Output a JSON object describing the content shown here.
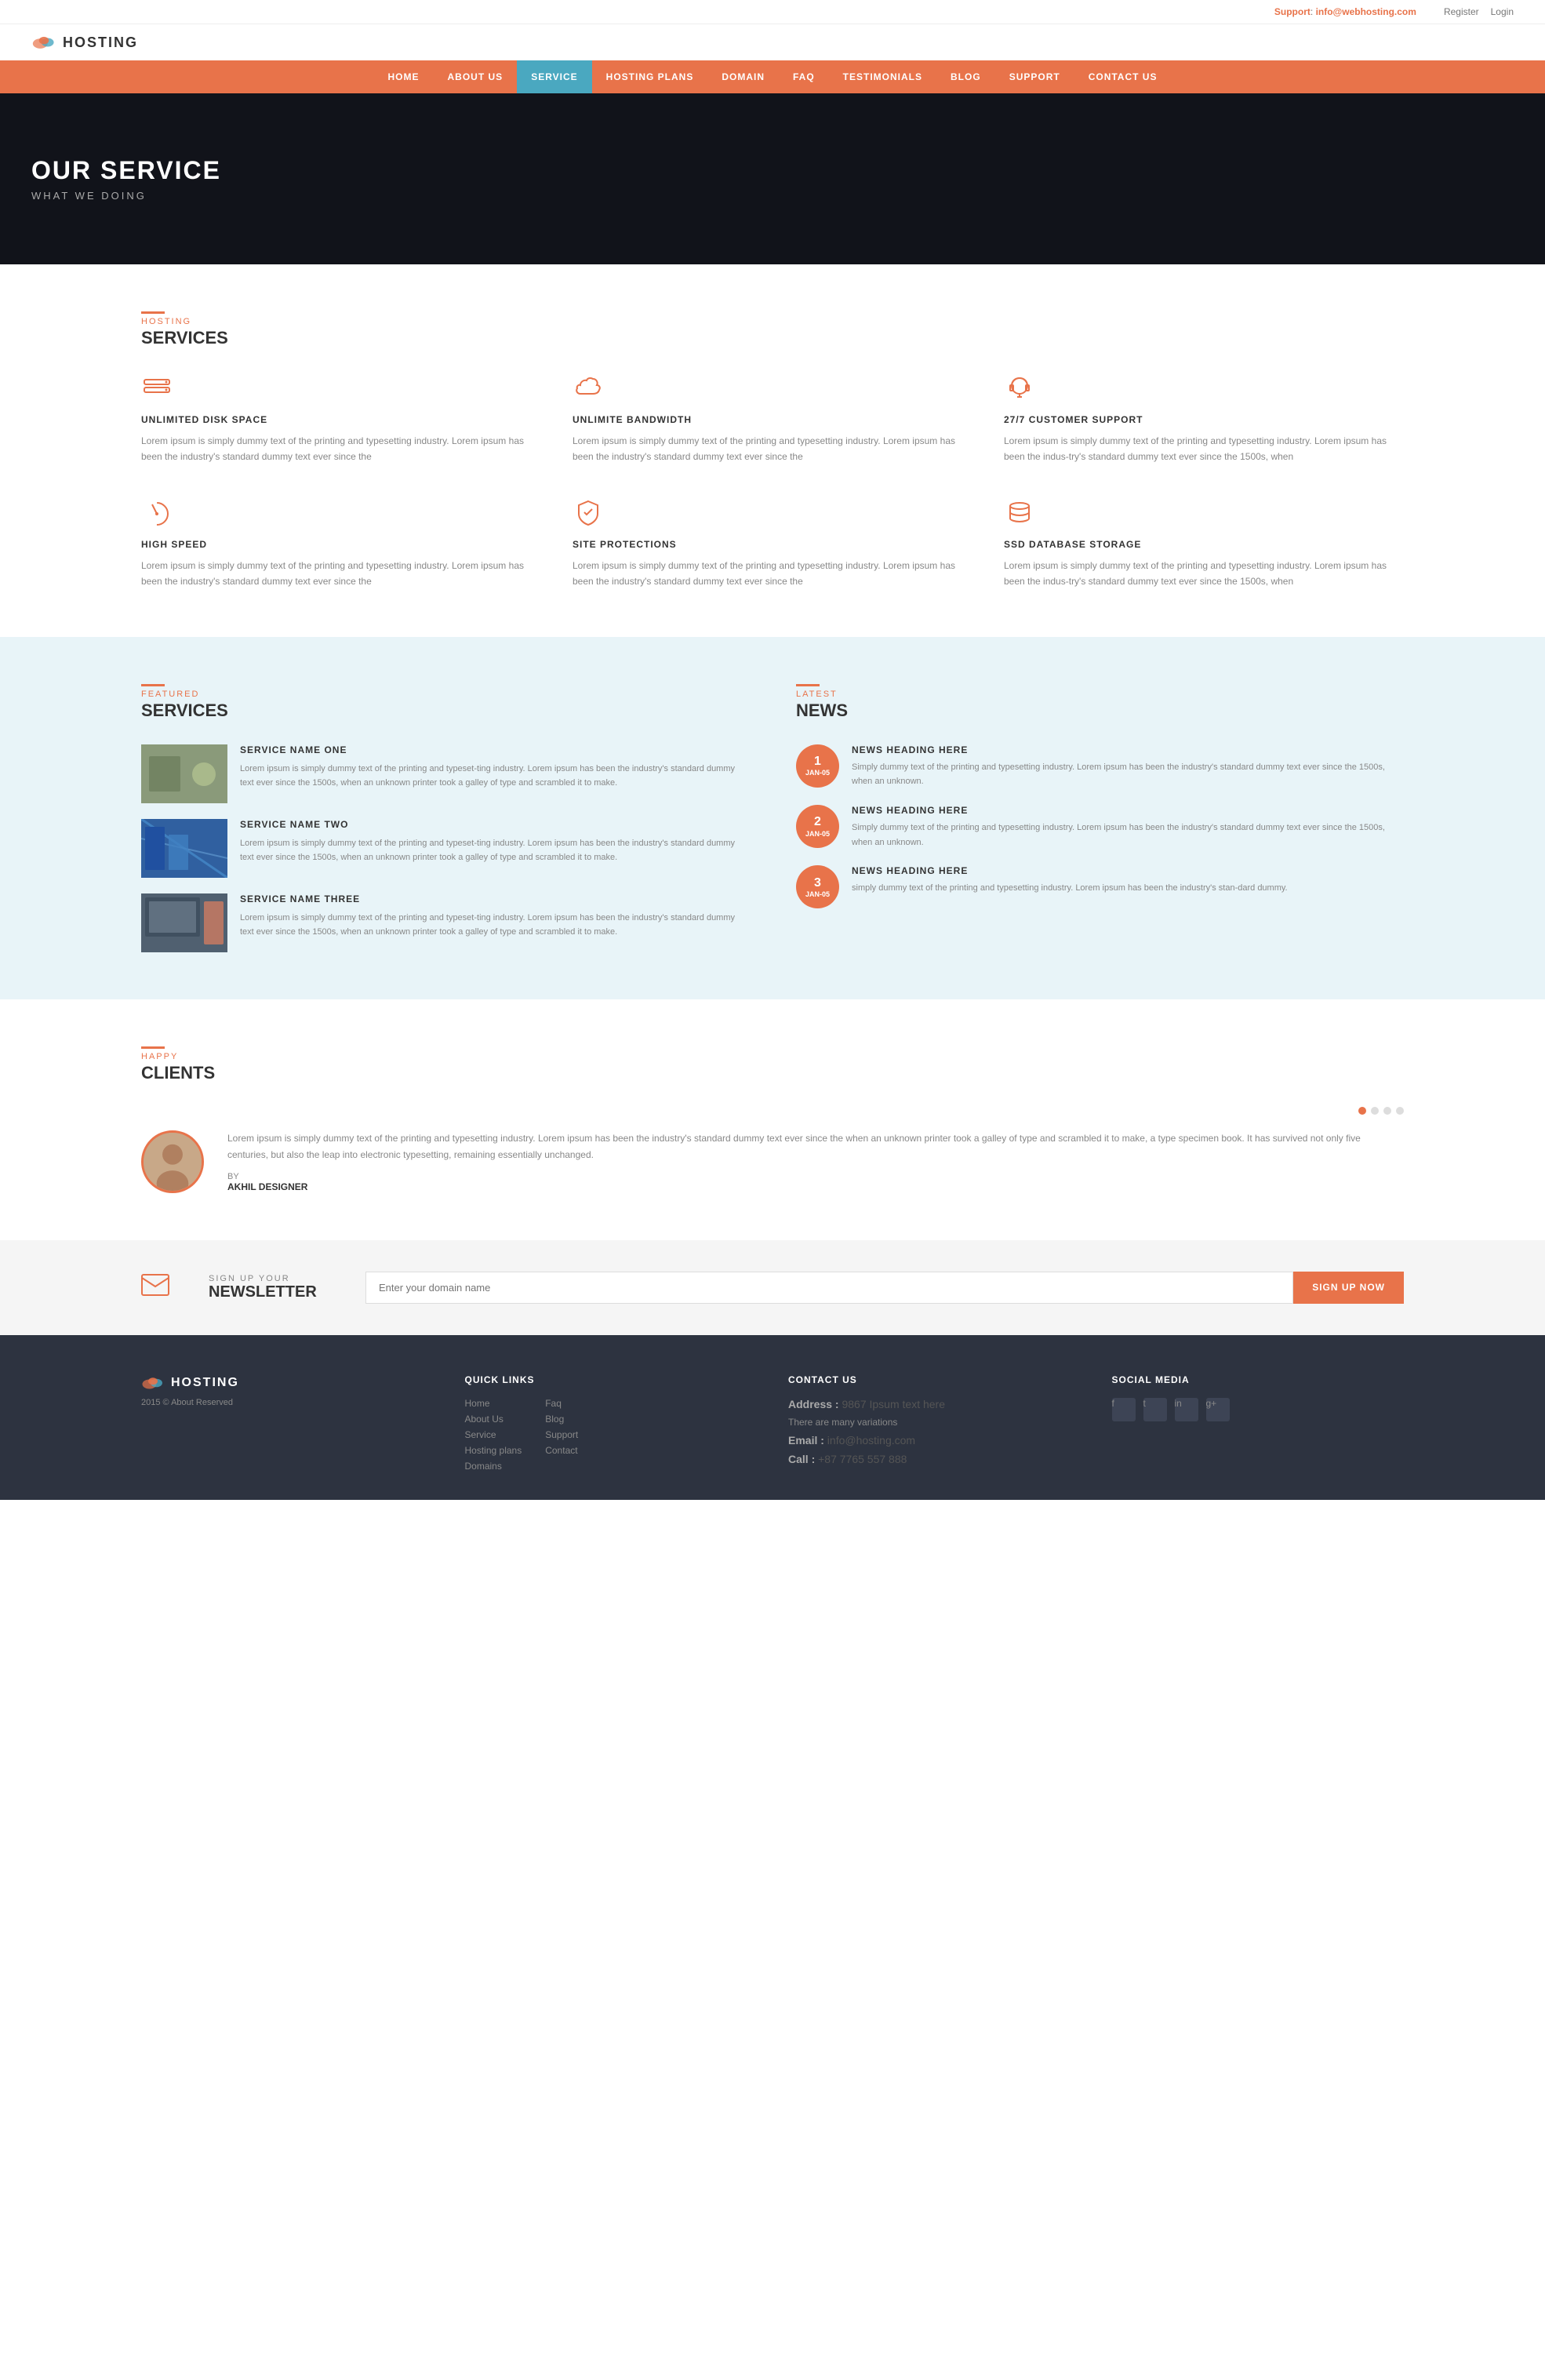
{
  "header": {
    "logo_text": "HOSTING",
    "support_label": "Support",
    "support_email": "info@webhosting.com",
    "register": "Register",
    "login": "Login"
  },
  "nav": {
    "items": [
      {
        "label": "HOME",
        "active": false
      },
      {
        "label": "ABOUT US",
        "active": false
      },
      {
        "label": "SERVICE",
        "active": true
      },
      {
        "label": "HOSTING PLANS",
        "active": false
      },
      {
        "label": "DOMAIN",
        "active": false
      },
      {
        "label": "FAQ",
        "active": false
      },
      {
        "label": "TESTIMONIALS",
        "active": false
      },
      {
        "label": "BLOG",
        "active": false
      },
      {
        "label": "SUPPORT",
        "active": false
      },
      {
        "label": "CONTACT US",
        "active": false
      }
    ]
  },
  "hero": {
    "title": "OUR SERVICE",
    "subtitle": "WHAT WE DOING"
  },
  "hosting_services": {
    "label": "HOSTING",
    "title": "SERVICES",
    "items": [
      {
        "icon": "disk",
        "title": "UNLIMITED DISK SPACE",
        "text": "Lorem ipsum is simply dummy text of the printing and typesetting industry. Lorem ipsum has been the industry's standard dummy text ever since the"
      },
      {
        "icon": "cloud",
        "title": "UNLIMITE BANDWIDTH",
        "text": "Lorem ipsum is simply dummy text of the printing and typesetting industry. Lorem ipsum has been the industry's standard dummy text ever since the"
      },
      {
        "icon": "headset",
        "title": "27/7 CUSTOMER SUPPORT",
        "text": "Lorem ipsum is simply dummy text of the printing and typesetting industry. Lorem ipsum has been the indus-try's standard dummy text ever since the 1500s, when"
      },
      {
        "icon": "speed",
        "title": "HIGH SPEED",
        "text": "Lorem ipsum is simply dummy text of the printing and typesetting industry. Lorem ipsum has been the industry's standard dummy text ever since the"
      },
      {
        "icon": "shield",
        "title": "SITE PROTECTIONS",
        "text": "Lorem ipsum is simply dummy text of the printing and typesetting industry. Lorem ipsum has been the industry's standard dummy text ever since the"
      },
      {
        "icon": "database",
        "title": "SSD DATABASE STORAGE",
        "text": "Lorem ipsum is simply dummy text of the printing and typesetting industry. Lorem ipsum has been the indus-try's standard dummy text ever since the 1500s, when"
      }
    ]
  },
  "featured": {
    "label": "FEATURED",
    "title": "SERVICES",
    "items": [
      {
        "title": "SERVICE NAME ONE",
        "text": "Lorem ipsum is simply dummy text of the printing and typeset-ting industry. Lorem ipsum has been the industry's standard dummy text ever since the 1500s, when an unknown printer took a galley of type and scrambled it to make."
      },
      {
        "title": "SERVICE NAME TWO",
        "text": "Lorem ipsum is simply dummy text of the printing and typeset-ting industry. Lorem ipsum has been the industry's standard dummy text ever since the 1500s, when an unknown printer took a galley of type and scrambled it to make."
      },
      {
        "title": "SERVICE NAME THREE",
        "text": "Lorem ipsum is simply dummy text of the printing and typeset-ting industry. Lorem ipsum has been the industry's standard dummy text ever since the 1500s, when an unknown printer took a galley of type and scrambled it to make."
      }
    ]
  },
  "news": {
    "label": "LATEST",
    "title": "NEWS",
    "items": [
      {
        "num": "1",
        "month": "JAN-05",
        "heading": "NEWS HEADING HERE",
        "text": "Simply dummy text of the printing and typesetting industry. Lorem ipsum has been the industry's standard dummy text ever since the 1500s, when an unknown."
      },
      {
        "num": "2",
        "month": "JAN-05",
        "heading": "NEWS HEADING HERE",
        "text": "Simply dummy text of the printing and typesetting industry. Lorem ipsum has been the industry's standard dummy text ever since the 1500s, when an unknown."
      },
      {
        "num": "3",
        "month": "JAN-05",
        "heading": "NEWS HEADING HERE",
        "text": "simply dummy text of the printing and typesetting industry. Lorem ipsum has been the industry's stan-dard dummy."
      }
    ]
  },
  "clients": {
    "label": "HAPPY",
    "title": "CLIENTS",
    "testimonial": {
      "text": "Lorem ipsum is simply dummy text of the printing and typesetting industry. Lorem ipsum has been the industry's standard dummy text ever since the when an unknown printer took a galley of type and scrambled it to make, a type specimen book. It has survived not only five centuries, but also the leap into electronic typesetting, remaining essentially unchanged.",
      "by": "BY",
      "name": "AKHIL DESIGNER"
    }
  },
  "newsletter": {
    "top_label": "SIGN UP YOUR",
    "title": "NEWSLETTER",
    "placeholder": "Enter your domain name",
    "button": "SIGN UP NOW"
  },
  "footer": {
    "logo_text": "HOSTING",
    "copyright": "2015 © About Reserved",
    "quick_links": {
      "title": "QUICK LINKS",
      "col1": [
        "Home",
        "About Us",
        "Service",
        "Hosting plans",
        "Domains"
      ],
      "col2": [
        "Faq",
        "Blog",
        "Support",
        "Contact"
      ]
    },
    "contact": {
      "title": "CONTACT US",
      "address_label": "Address :",
      "address_value": "9867 Ipsum text here",
      "address2": "There are many variations",
      "email_label": "Email :",
      "email_value": "info@hosting.com",
      "call_label": "Call :",
      "call_value": "+87 7765 557 888"
    },
    "social": {
      "title": "SOCIAL MEDIA",
      "icons": [
        "f",
        "t",
        "in",
        "g+"
      ]
    }
  }
}
